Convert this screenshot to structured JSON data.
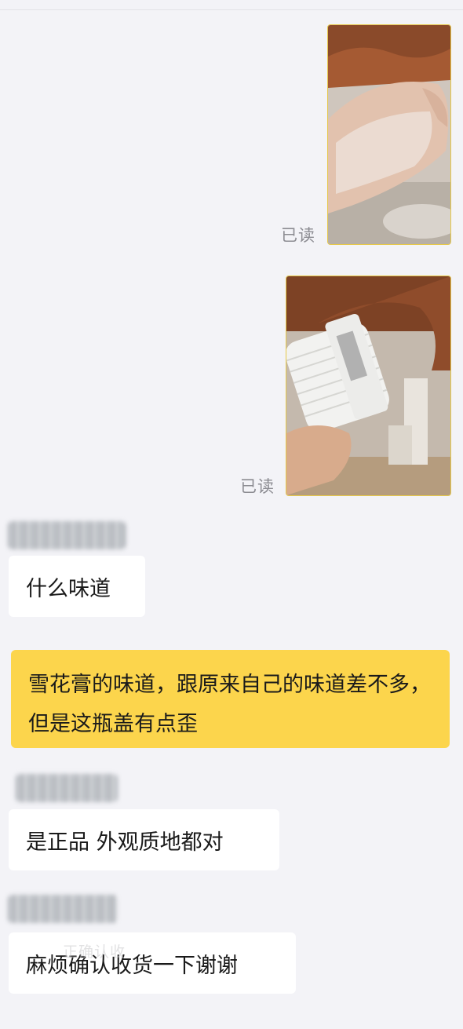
{
  "messages": [
    {
      "type": "image",
      "icon": "photo-hand-lotion-icon",
      "status": "已读"
    },
    {
      "type": "image",
      "icon": "photo-jar-icon",
      "status": "已读"
    },
    {
      "type": "text",
      "side": "left",
      "text": "什么味道"
    },
    {
      "type": "text",
      "side": "right",
      "text": "雪花膏的味道，跟原来自己的味道差不多，但是这瓶盖有点歪"
    },
    {
      "type": "text",
      "side": "left",
      "text": "是正品 外观质地都对"
    },
    {
      "type": "text",
      "side": "left",
      "text": "麻烦确认收货一下谢谢",
      "watermark": "正确认收"
    }
  ],
  "colors": {
    "background": "#f3f3f7",
    "own_bubble": "#fcd54c",
    "other_bubble": "#ffffff",
    "status_text": "#8c8c92"
  }
}
